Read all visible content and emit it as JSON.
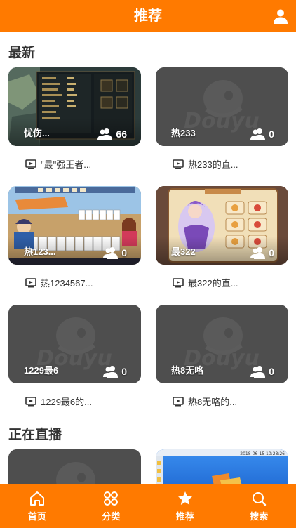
{
  "header": {
    "title": "推荐",
    "user_icon": "user-icon"
  },
  "sections": {
    "latest": {
      "title": "最新"
    },
    "live": {
      "title": "正在直播"
    }
  },
  "cards": [
    {
      "name": "忧伤...",
      "viewers": "66",
      "caption": "\"最\"强王者...",
      "thumb": "game-screenshot-moba"
    },
    {
      "name": "热233",
      "viewers": "0",
      "caption": "热233的直...",
      "thumb": "douyu-placeholder"
    },
    {
      "name": "热123...",
      "viewers": "0",
      "caption": "热1234567...",
      "thumb": "game-screenshot-cards"
    },
    {
      "name": "最322",
      "viewers": "0",
      "caption": "最322的直...",
      "thumb": "game-screenshot-fantasy"
    },
    {
      "name": "1229最6",
      "viewers": "0",
      "caption": "1229最6的...",
      "thumb": "douyu-placeholder"
    },
    {
      "name": "热8无咯",
      "viewers": "0",
      "caption": "热8无咯的...",
      "thumb": "douyu-placeholder"
    },
    {
      "name": "",
      "viewers": "",
      "caption": "",
      "thumb": "douyu-placeholder"
    },
    {
      "name": "",
      "viewers": "",
      "caption": "",
      "thumb": "desktop-screenshot",
      "timestamp": "2018-06-15 10:28:26"
    }
  ],
  "placeholder_watermark": "Douyu",
  "tabs": [
    {
      "label": "首页",
      "icon": "home-icon"
    },
    {
      "label": "分类",
      "icon": "category-icon"
    },
    {
      "label": "推荐",
      "icon": "star-icon"
    },
    {
      "label": "搜索",
      "icon": "search-icon"
    }
  ],
  "colors": {
    "accent": "#ff7a00",
    "placeholder": "#4e4e4e"
  }
}
